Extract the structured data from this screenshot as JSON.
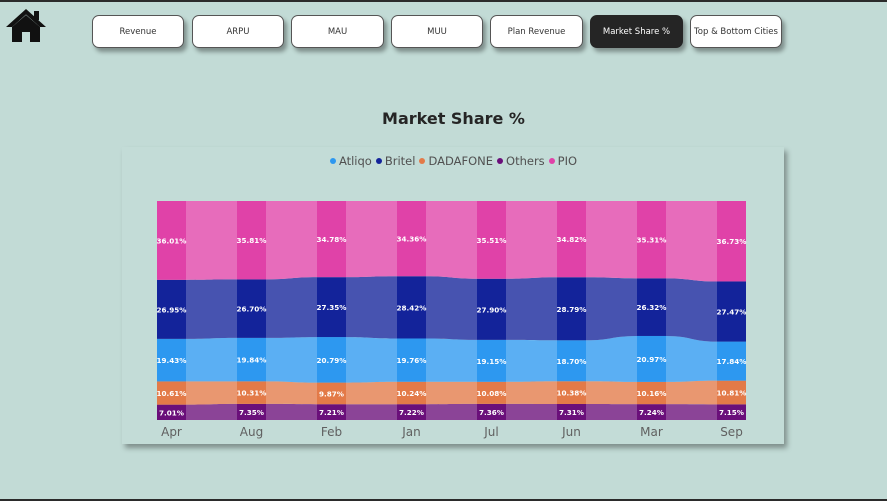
{
  "nav": {
    "items": [
      {
        "label": "Revenue",
        "active": false
      },
      {
        "label": "ARPU",
        "active": false
      },
      {
        "label": "MAU",
        "active": false
      },
      {
        "label": "MUU",
        "active": false
      },
      {
        "label": "Plan Revenue",
        "active": false
      },
      {
        "label": "Market Share %",
        "active": true
      },
      {
        "label": "Top & Bottom Cities",
        "active": false
      }
    ]
  },
  "chart_data": {
    "type": "bar",
    "title": "Market Share %",
    "categories": [
      "Apr",
      "Aug",
      "Feb",
      "Jan",
      "Jul",
      "Jun",
      "Mar",
      "Sep"
    ],
    "series": [
      {
        "name": "Others",
        "color": "#6a0f7a",
        "values": [
          7.01,
          7.35,
          7.21,
          7.22,
          7.36,
          7.31,
          7.24,
          7.15
        ]
      },
      {
        "name": "DADAFONE",
        "color": "#e37a48",
        "values": [
          10.61,
          10.31,
          9.87,
          10.24,
          10.08,
          10.38,
          10.16,
          10.81
        ]
      },
      {
        "name": "Atliqo",
        "color": "#2d98f0",
        "values": [
          19.43,
          19.84,
          20.79,
          19.76,
          19.15,
          18.7,
          20.97,
          17.84
        ]
      },
      {
        "name": "Britel",
        "color": "#13239a",
        "values": [
          26.95,
          26.7,
          27.35,
          28.42,
          27.9,
          28.79,
          26.32,
          27.47
        ]
      },
      {
        "name": "PIO",
        "color": "#e042a8",
        "values": [
          36.01,
          35.81,
          34.78,
          34.36,
          35.51,
          34.82,
          35.31,
          36.73
        ]
      }
    ],
    "data_labels": [
      [
        "7.01%",
        "7.35%",
        "7.21%",
        "7.22%",
        "7.36%",
        "7.31%",
        "7.24%",
        "7.15%"
      ],
      [
        "10.61%",
        "10.31%",
        "9.87%",
        "10.24%",
        "10.08%",
        "10.38%",
        "10.16%",
        "10.81%"
      ],
      [
        "19.43%",
        "19.84%",
        "20.79%",
        "19.76%",
        "19.15%",
        "18.70%",
        "20.97%",
        "17.84%"
      ],
      [
        "26.95%",
        "26.70%",
        "27.35%",
        "28.42%",
        "27.90%",
        "28.79%",
        "26.32%",
        "27.47%"
      ],
      [
        "36.01%",
        "35.81%",
        "34.78%",
        "34.36%",
        "35.51%",
        "34.82%",
        "35.31%",
        "36.73%"
      ]
    ],
    "legend": {
      "position": "top-center",
      "order": [
        "Atliqo",
        "Britel",
        "DADAFONE",
        "Others",
        "PIO"
      ]
    },
    "stacking": "100%",
    "ribbons_between_bars": true,
    "grid": false,
    "ylim": [
      0,
      100
    ]
  }
}
